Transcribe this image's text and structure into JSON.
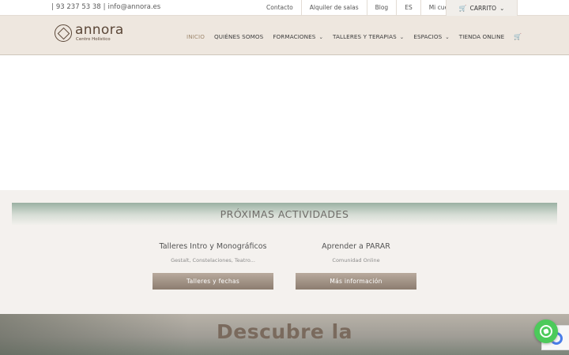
{
  "topbar": {
    "phone": "93 237 53 38",
    "email": "info@annora.es",
    "links": [
      {
        "label": "Contacto",
        "dropdown": false
      },
      {
        "label": "Alquiler de salas",
        "dropdown": false
      },
      {
        "label": "Blog",
        "dropdown": false
      },
      {
        "label": "ES",
        "dropdown": false
      },
      {
        "label": "Mi cuenta",
        "dropdown": true
      }
    ],
    "cart_label": "CARRITO"
  },
  "header": {
    "brand": "annora",
    "tagline": "Centro Holístico",
    "nav": [
      {
        "label": "INICIO",
        "active": true,
        "dropdown": false
      },
      {
        "label": "QUIÉNES SOMOS",
        "active": false,
        "dropdown": false
      },
      {
        "label": "FORMACIONES",
        "active": false,
        "dropdown": true
      },
      {
        "label": "TALLERES Y TERAPIAS",
        "active": false,
        "dropdown": true
      },
      {
        "label": "ESPACIOS",
        "active": false,
        "dropdown": true
      },
      {
        "label": "TIENDA ONLINE",
        "active": false,
        "dropdown": false
      }
    ]
  },
  "activities": {
    "title": "PRÓXIMAS ACTIVIDADES",
    "columns": [
      {
        "title": "Talleres Intro y Monográficos",
        "subtitle": "Gestalt, Constelaciones, Teatro...",
        "button": "Talleres y fechas"
      },
      {
        "title": "Aprender a PARAR",
        "subtitle": "Comunidad Online",
        "button": "Más información"
      }
    ]
  },
  "banner": {
    "title": "Descubre la"
  },
  "icons": {
    "cart": "cart-icon",
    "chevron": "chevron-down-icon",
    "whatsapp": "whatsapp-icon",
    "recaptcha": "recaptcha-icon"
  },
  "colors": {
    "header_bg": "#eee7df",
    "accent": "#a08a70",
    "button": "#a09285",
    "whatsapp": "#4cca5a"
  }
}
